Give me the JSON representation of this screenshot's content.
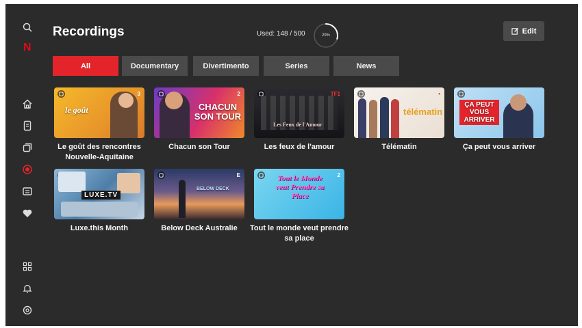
{
  "brand": "N",
  "header": {
    "title": "Recordings",
    "usage_text": "Used: 148 / 500",
    "usage_percent_label": "29%",
    "usage_fraction": 0.296,
    "edit_label": "Edit"
  },
  "tabs": [
    {
      "label": "All",
      "active": true
    },
    {
      "label": "Documentary",
      "active": false
    },
    {
      "label": "Divertimento",
      "active": false
    },
    {
      "label": "Series",
      "active": false
    },
    {
      "label": "News",
      "active": false
    }
  ],
  "recordings": [
    {
      "title": "Le goût des rencontres Nouvelle-Aquitaine",
      "thumb_text": "le goût",
      "badge": "3"
    },
    {
      "title": "Chacun son Tour",
      "thumb_text": "CHACUN SON TOUR",
      "badge": "2"
    },
    {
      "title": "Les feux de l'amour",
      "thumb_text": "Les Feux de l'Amour",
      "badge": "TF1"
    },
    {
      "title": "Télématin",
      "thumb_text": "télématin",
      "badge": "•"
    },
    {
      "title": "Ça peut vous arriver",
      "thumb_text": "ÇA PEUT VOUS ARRIVER",
      "badge": ""
    },
    {
      "title": "Luxe.this Month",
      "thumb_text": "LUXE.TV",
      "badge": ""
    },
    {
      "title": "Below Deck Australie",
      "thumb_text": "BELOW DECK",
      "badge": "E"
    },
    {
      "title": "Tout le monde veut prendre sa place",
      "thumb_text": "Tout le Monde veut Prendre sa Place",
      "badge": "2"
    }
  ],
  "colors": {
    "background": "#2b2b2b",
    "accent": "#e3252b",
    "tab": "#4a4a4a"
  }
}
